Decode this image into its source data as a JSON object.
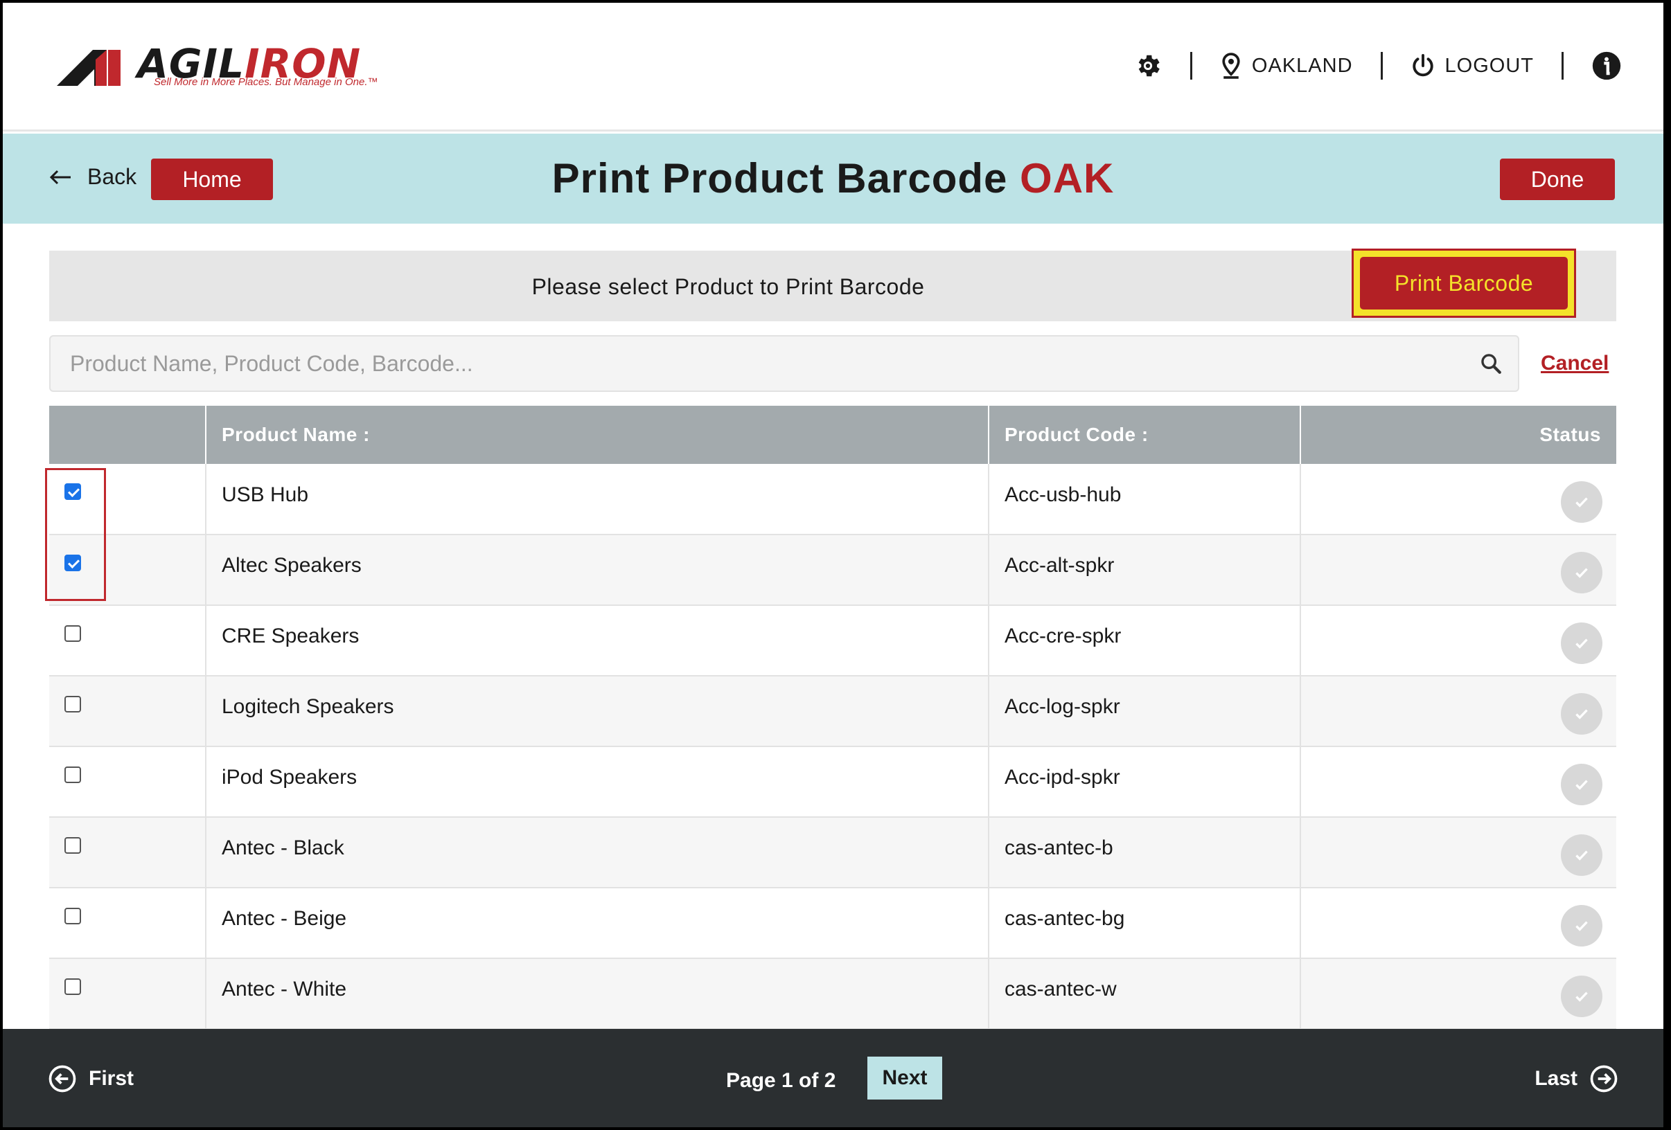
{
  "logo": {
    "brand_prefix": "AGIL",
    "brand_suffix": "IRON",
    "tagline": "Sell More in More Places. But Manage in One.™"
  },
  "topnav": {
    "location": "OAKLAND",
    "logout": "LOGOUT"
  },
  "titlebar": {
    "back": "Back",
    "home": "Home",
    "title": "Print Product Barcode",
    "location_code": "OAK",
    "done": "Done"
  },
  "selectbar": {
    "message": "Please select Product to Print Barcode",
    "print_button": "Print Barcode"
  },
  "search": {
    "placeholder": "Product Name, Product Code, Barcode...",
    "cancel": "Cancel"
  },
  "table": {
    "headers": {
      "product_name": "Product Name :",
      "product_code": "Product Code :",
      "status": "Status"
    },
    "rows": [
      {
        "name": "USB Hub",
        "code": "Acc-usb-hub",
        "checked": true
      },
      {
        "name": "Altec Speakers",
        "code": "Acc-alt-spkr",
        "checked": true
      },
      {
        "name": "CRE Speakers",
        "code": "Acc-cre-spkr",
        "checked": false
      },
      {
        "name": "Logitech Speakers",
        "code": "Acc-log-spkr",
        "checked": false
      },
      {
        "name": "iPod Speakers",
        "code": "Acc-ipd-spkr",
        "checked": false
      },
      {
        "name": "Antec - Black",
        "code": "cas-antec-b",
        "checked": false
      },
      {
        "name": "Antec - Beige",
        "code": "cas-antec-bg",
        "checked": false
      },
      {
        "name": "Antec - White",
        "code": "cas-antec-w",
        "checked": false
      }
    ]
  },
  "footer": {
    "first": "First",
    "page_info": "Page 1 of 2",
    "next": "Next",
    "last": "Last"
  },
  "colors": {
    "brand_red": "#b32025",
    "title_bar_bg": "#bde3e6",
    "print_highlight": "#f4e22a",
    "footer_bg": "#2b2f31",
    "checkbox_checked": "#1a73e8"
  },
  "icons": {
    "settings": "gear-icon",
    "location": "map-pin-icon",
    "logout": "power-icon",
    "info": "info-icon",
    "back": "arrow-left-icon",
    "search": "search-icon",
    "status": "check-circle-icon",
    "first": "circle-arrow-left-icon",
    "last": "circle-arrow-right-icon"
  }
}
